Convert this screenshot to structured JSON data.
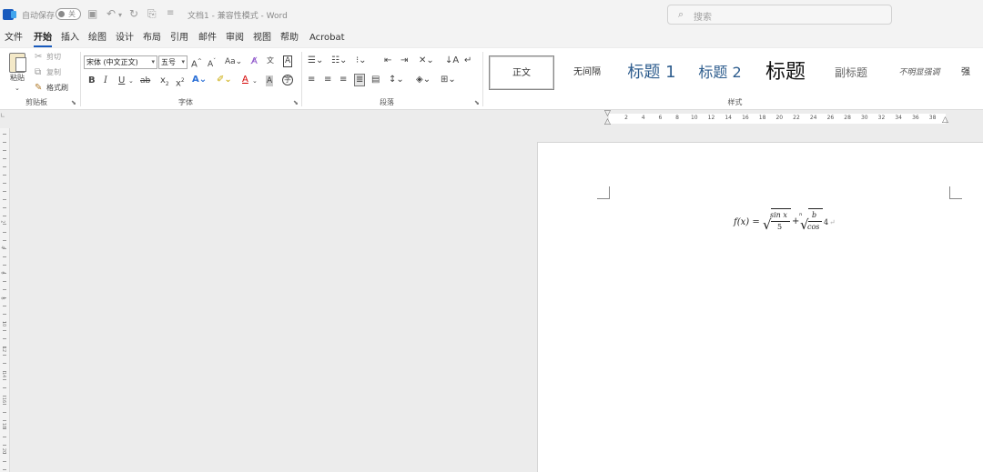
{
  "titlebar": {
    "autosave_label": "自动保存",
    "toggle_text": "关",
    "title": "文档1  -  兼容性模式  -  Word",
    "search_placeholder": "搜索"
  },
  "menu": {
    "tabs": [
      "文件",
      "开始",
      "插入",
      "绘图",
      "设计",
      "布局",
      "引用",
      "邮件",
      "审阅",
      "视图",
      "帮助",
      "Acrobat"
    ],
    "active_tab": "开始"
  },
  "ribbon": {
    "clipboard": {
      "paste_label": "粘贴",
      "cut_label": "剪切",
      "copy_label": "复制",
      "format_painter_label": "格式刷",
      "group_label": "剪贴板"
    },
    "font": {
      "font_name": "宋体 (中文正文)",
      "font_size": "五号",
      "group_label": "字体"
    },
    "paragraph": {
      "group_label": "段落"
    },
    "styles": {
      "group_label": "样式",
      "items": [
        "正文",
        "无间隔",
        "标题 1",
        "标题 2",
        "标题",
        "副标题",
        "不明显强调",
        "强"
      ]
    }
  },
  "ruler": {
    "numbers": [
      "2",
      "4",
      "6",
      "8",
      "10",
      "12",
      "14",
      "16",
      "18",
      "20",
      "22",
      "24",
      "26",
      "28",
      "30",
      "32",
      "34",
      "36",
      "38"
    ]
  },
  "vertical_ruler": {
    "numbers": [
      "2",
      "4",
      "6",
      "8",
      "10",
      "12",
      "14",
      "16",
      "18",
      "20"
    ]
  },
  "document": {
    "equation": {
      "lhs": "f(x) =",
      "frac1_num": "sin x",
      "frac1_den": "5",
      "plus": "+",
      "root_index": "n",
      "frac2_num": "b",
      "frac2_den": "cos",
      "tail": "4"
    }
  },
  "colors": {
    "accent": "#185abd",
    "heading": "#2e5d8e"
  }
}
